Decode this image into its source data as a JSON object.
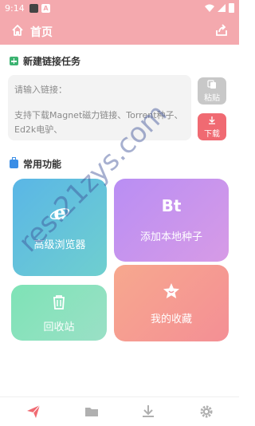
{
  "status_bar": {
    "time": "9:14",
    "badge": "A"
  },
  "header": {
    "title": "首页"
  },
  "new_task": {
    "title": "新建链接任务",
    "input_placeholder": "请输入链接：",
    "hint": "支持下载Magnet磁力链接、Torrent种子、Ed2k电驴、",
    "paste_label": "粘贴",
    "download_label": "下载"
  },
  "functions": {
    "title": "常用功能",
    "browser_label": "高级浏览器",
    "torrent_icon_text": "Bt",
    "torrent_label": "添加本地种子",
    "recycle_label": "回收站",
    "favorites_label": "我的收藏"
  },
  "watermark": "res.21zys.com",
  "colors": {
    "primary": "#f4a9ae",
    "download_btn": "#f06a72",
    "nav_active": "#f06a72",
    "nav_inactive": "#b0b0b0"
  },
  "nav": {
    "items": [
      "send-icon",
      "folder-icon",
      "download-icon",
      "settings-icon"
    ],
    "active": "send-icon"
  }
}
